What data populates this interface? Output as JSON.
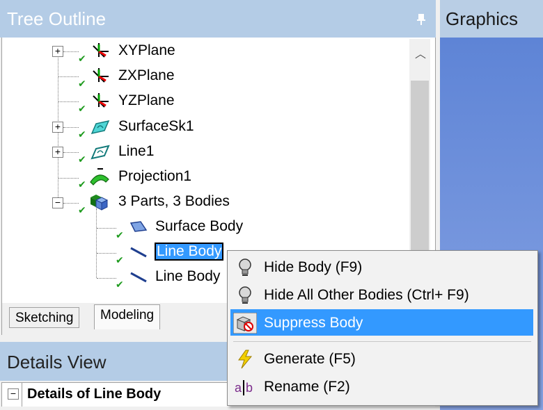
{
  "tree_panel": {
    "title": "Tree Outline",
    "items": [
      {
        "label": "XYPlane",
        "icon": "plane-axes-icon",
        "expandable": true
      },
      {
        "label": "ZXPlane",
        "icon": "plane-axes-icon",
        "expandable": false
      },
      {
        "label": "YZPlane",
        "icon": "plane-axes-icon",
        "expandable": false
      },
      {
        "label": "SurfaceSk1",
        "icon": "surface-sketch-icon",
        "expandable": true
      },
      {
        "label": "Line1",
        "icon": "line-sketch-icon",
        "expandable": true
      },
      {
        "label": "Projection1",
        "icon": "projection-icon",
        "expandable": false
      },
      {
        "label": "3 Parts, 3 Bodies",
        "icon": "parts-bodies-icon",
        "expandable": true,
        "expanded": true
      },
      {
        "label": "Surface Body",
        "icon": "surface-body-icon"
      },
      {
        "label": "Line Body",
        "icon": "line-body-icon",
        "selected": true
      },
      {
        "label": "Line Body",
        "icon": "line-body-icon"
      }
    ]
  },
  "graphics_panel": {
    "title": "Graphics"
  },
  "tabs": [
    {
      "label": "Sketching",
      "active": false
    },
    {
      "label": "Modeling",
      "active": true
    }
  ],
  "details_panel": {
    "title": "Details View",
    "row_label": "Details of Line Body"
  },
  "context_menu": {
    "items": [
      {
        "label": "Hide Body (F9)",
        "icon": "lightbulb-icon"
      },
      {
        "label": "Hide All Other Bodies (Ctrl+ F9)",
        "icon": "lightbulb-icon"
      },
      {
        "label": "Suppress Body",
        "icon": "suppress-body-icon",
        "highlighted": true
      },
      {
        "label": "Generate (F5)",
        "icon": "lightning-icon"
      },
      {
        "label": "Rename (F2)",
        "icon": "rename-icon"
      }
    ]
  },
  "colors": {
    "panel_header": "#b4cce6",
    "selection": "#3399ff",
    "graphics_bg": "#6a8ddb",
    "check_green": "#1e9b1e"
  }
}
